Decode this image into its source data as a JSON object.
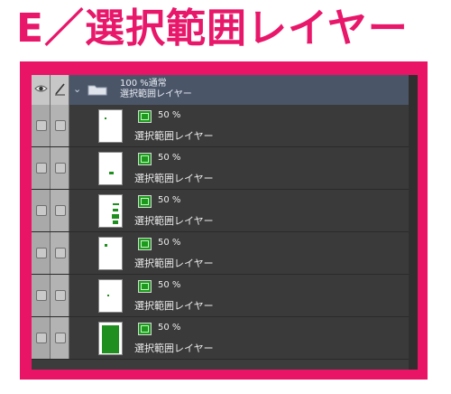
{
  "title": "E／選択範囲レイヤー",
  "folder": {
    "opacity_blend": "100 %通常",
    "name": "選択範囲レイヤー"
  },
  "layers": [
    {
      "opacity": "50 %",
      "name": "選択範囲レイヤー"
    },
    {
      "opacity": "50 %",
      "name": "選択範囲レイヤー"
    },
    {
      "opacity": "50 %",
      "name": "選択範囲レイヤー"
    },
    {
      "opacity": "50 %",
      "name": "選択範囲レイヤー"
    },
    {
      "opacity": "50 %",
      "name": "選択範囲レイヤー"
    },
    {
      "opacity": "50 %",
      "name": "選択範囲レイヤー"
    }
  ],
  "colors": {
    "accent_pink": "#e8176a",
    "selection_green": "#1c9a1c",
    "panel_bg": "#3c3c3c"
  }
}
